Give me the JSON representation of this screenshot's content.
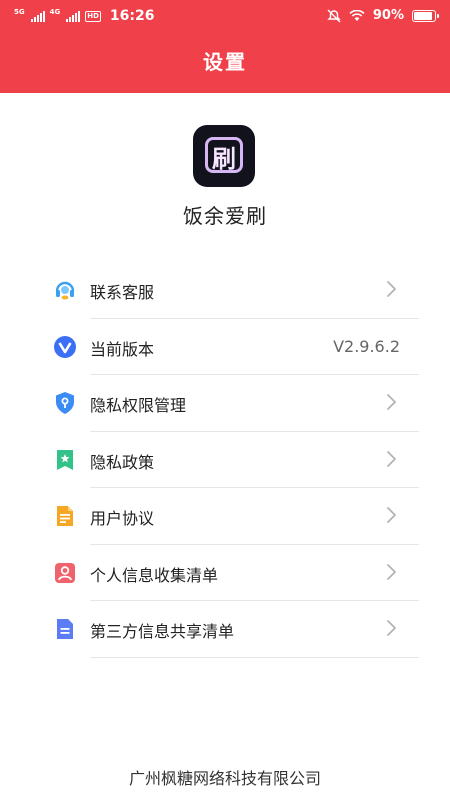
{
  "status_bar": {
    "sim1": "5G",
    "sim2": "4G",
    "hd": "HD",
    "time": "16:26",
    "battery_percent": "90%",
    "battery_level": 0.9,
    "icons": [
      "mute-icon",
      "wifi-icon",
      "battery-icon"
    ]
  },
  "header": {
    "title": "设置",
    "color": "#f0414b"
  },
  "app": {
    "logo_glyph": "刷",
    "name": "饭余爱刷"
  },
  "menu": [
    {
      "label": "联系客服",
      "icon": "customer-service-icon",
      "color": "#3aa0f0"
    },
    {
      "label": "当前版本",
      "icon": "version-icon",
      "color": "#3b6ff5",
      "value": "V2.9.6.2"
    },
    {
      "label": "隐私权限管理",
      "icon": "privacy-shield-icon",
      "color": "#3b8cf5"
    },
    {
      "label": "隐私政策",
      "icon": "privacy-policy-icon",
      "color": "#33c38a"
    },
    {
      "label": "用户协议",
      "icon": "user-agreement-icon",
      "color": "#f5a623"
    },
    {
      "label": "个人信息收集清单",
      "icon": "personal-info-icon",
      "color": "#f0636b"
    },
    {
      "label": "第三方信息共享清单",
      "icon": "third-party-share-icon",
      "color": "#5b7cf5"
    }
  ],
  "footer": {
    "company": "广州枫糖网络科技有限公司"
  }
}
